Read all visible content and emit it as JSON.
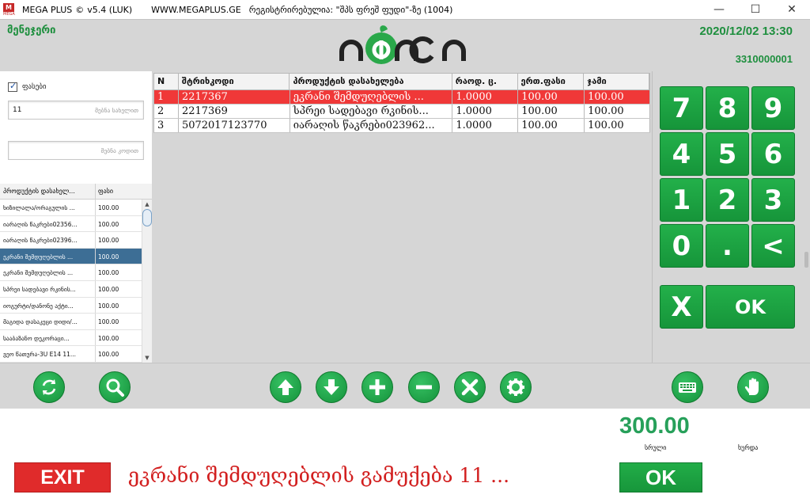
{
  "titlebar": {
    "app": "MEGA PLUS",
    "copyright": "©",
    "version": "v5.4 (LUK)",
    "site": "WWW.MEGAPLUS.GE",
    "registered": "რეგისტრირებულია: \"შპს ფრეშ ფუდი\"-ზე (1004)",
    "logo_letters": "M",
    "logo_sub": "MEGA",
    "min": "—",
    "max": "☐",
    "close": "✕"
  },
  "header": {
    "user": "მენეჯერი",
    "datetime": "2020/12/02 13:30",
    "code": "3310000001"
  },
  "left": {
    "price_checkbox_label": "ფასები",
    "name_search_value": "11",
    "name_search_placeholder": "მებნა სახელით",
    "code_search_value": "",
    "code_search_placeholder": "მებნა კოდით",
    "list_headers": [
      "პროდუქტის დასახელ...",
      "ფასი"
    ],
    "products": [
      {
        "name": "ხიზილალა/ორაგულის ...",
        "price": "100.00"
      },
      {
        "name": "იარაღის წაკრები02356...",
        "price": "100.00"
      },
      {
        "name": "იარაღის წაკრები02396...",
        "price": "100.00"
      },
      {
        "name": "ეკრანი შემდუღებლის  ...",
        "price": "100.00"
      },
      {
        "name": "ეკრანი შემდუღებლის ...",
        "price": "100.00"
      },
      {
        "name": "სპრეი სადებავი რკინის...",
        "price": "100.00"
      },
      {
        "name": "იოგურტი/დანონე აქტი...",
        "price": "100.00"
      },
      {
        "name": "მაგიდა დასაკეცი დიდი/...",
        "price": "100.00"
      },
      {
        "name": "სააბაზანო დეკორაცი...",
        "price": "100.00"
      },
      {
        "name": "ვეო წათურა-3U E14 11...",
        "price": "100.00"
      }
    ],
    "selected_index": 3
  },
  "table": {
    "headers": [
      "N",
      "შტრიხკოდი",
      "პროდუქტის დასახელება",
      "რაოდ. ც.",
      "ერთ.ფასი",
      "ჯამი"
    ],
    "rows": [
      {
        "n": "1",
        "barcode": "2217367",
        "name": "ეკრანი შემდუღებლის  ...",
        "qty": "1.0000",
        "unit": "100.00",
        "sum": "100.00"
      },
      {
        "n": "2",
        "barcode": "2217369",
        "name": "სპრეი სადებავი რკინის...",
        "qty": "1.0000",
        "unit": "100.00",
        "sum": "100.00"
      },
      {
        "n": "3",
        "barcode": "5072017123770",
        "name": "იარაღის წაკრები023962...",
        "qty": "1.0000",
        "unit": "100.00",
        "sum": "100.00"
      }
    ],
    "selected_index": 0
  },
  "keypad": {
    "keys": [
      "7",
      "8",
      "9",
      "4",
      "5",
      "6",
      "1",
      "2",
      "3",
      "0",
      ".",
      "<"
    ],
    "clear": "X",
    "ok": "OK"
  },
  "toolbar": {
    "icons": [
      "refresh-icon",
      "search-icon",
      "arrow-up-icon",
      "arrow-down-icon",
      "plus-icon",
      "minus-icon",
      "close-icon",
      "gear-icon",
      "keyboard-icon",
      "hand-icon"
    ]
  },
  "footer": {
    "total": "300.00",
    "label_full": "სრული",
    "label_change": "ხურდა",
    "exit": "EXIT",
    "message": "ეკრანი შემდუღებლის  გამუქება 11  ...",
    "ok": "OK"
  },
  "colors": {
    "green": "#1e8f3e",
    "key_green": "#1c9e42",
    "selected_row": "#f03838",
    "selected_list": "#3d6e95",
    "exit_red": "#e02b2b",
    "message_red": "#d21f1f"
  }
}
